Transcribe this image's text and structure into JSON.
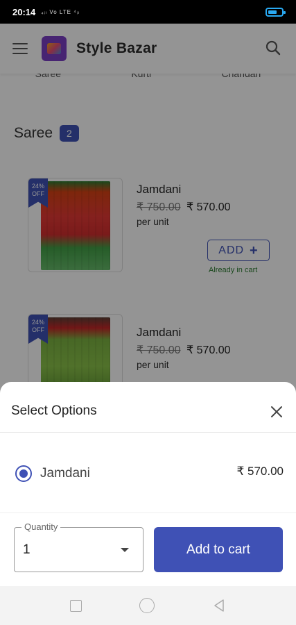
{
  "status_bar": {
    "time": "20:14",
    "icons_text": "₄ᵢₗ Vo LTE ⁴ᵢₗ"
  },
  "app_bar": {
    "title": "Style Bazar",
    "menu_icon": "hamburger-menu-icon",
    "search_icon": "search-icon"
  },
  "category_tabs": [
    "Saree",
    "Kurti",
    "Chandari"
  ],
  "section": {
    "title": "Saree",
    "count": "2"
  },
  "products": [
    {
      "name": "Jamdani",
      "old_price": "₹ 750.00",
      "new_price": "₹ 570.00",
      "unit": "per unit",
      "discount_line1": "24%",
      "discount_line2": "OFF",
      "add_label": "ADD",
      "cart_status": "Already in cart"
    },
    {
      "name": "Jamdani",
      "old_price": "₹ 750.00",
      "new_price": "₹ 570.00",
      "unit": "per unit",
      "discount_line1": "24%",
      "discount_line2": "OFF"
    }
  ],
  "sheet": {
    "title": "Select Options",
    "options": [
      {
        "label": "Jamdani",
        "price": "₹ 570.00",
        "selected": true
      }
    ],
    "quantity_label": "Quantity",
    "quantity_value": "1",
    "add_to_cart": "Add to cart"
  },
  "colors": {
    "accent": "#3f51b5",
    "in_cart": "#2e7d32",
    "battery": "#29a9f2"
  }
}
